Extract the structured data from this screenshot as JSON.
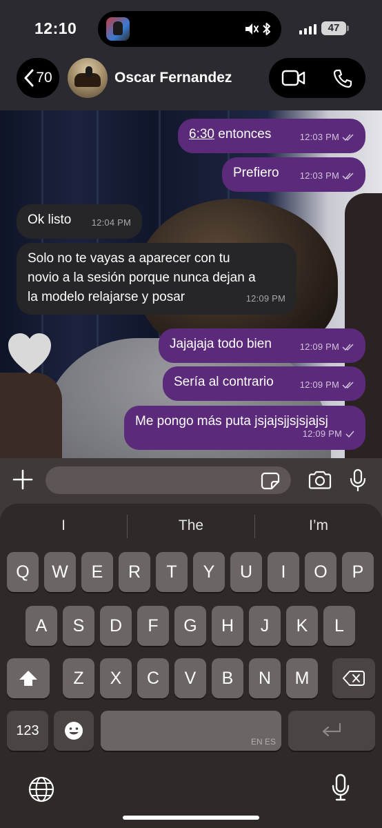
{
  "status_bar": {
    "time": "12:10",
    "battery": "47",
    "icons": [
      "app-icon",
      "mute-icon",
      "bluetooth-icon",
      "signal-icon",
      "battery-icon"
    ]
  },
  "header": {
    "back_count": "70",
    "contact_name": "Oscar Fernandez",
    "icons": [
      "back-chevron-icon",
      "video-call-icon",
      "phone-call-icon"
    ]
  },
  "messages": [
    {
      "direction": "out",
      "text_pre": "6:30",
      "text": " entonces",
      "time": "12:03 PM",
      "status": "read"
    },
    {
      "direction": "out",
      "text": "Prefiero",
      "time": "12:03 PM",
      "status": "read"
    },
    {
      "direction": "in",
      "text": "Ok listo",
      "time": "12:04 PM"
    },
    {
      "direction": "in",
      "lines": [
        "Solo no te vayas a aparecer con tu",
        "novio a la sesión porque nunca dejan a",
        "la modelo relajarse y posar"
      ],
      "time": "12:09 PM"
    },
    {
      "direction": "out",
      "text": "Jajajaja todo bien",
      "time": "12:09 PM",
      "status": "read"
    },
    {
      "direction": "out",
      "text": "Sería al contrario",
      "time": "12:09 PM",
      "status": "read"
    },
    {
      "direction": "out",
      "text": "Me pongo más puta jsjajsjjsjsjajsj",
      "time": "12:09 PM",
      "status": "delivered"
    }
  ],
  "reaction_icon": "heart-icon",
  "composer": {
    "placeholder": "",
    "icons": [
      "plus-icon",
      "sticker-icon",
      "camera-icon",
      "microphone-icon"
    ]
  },
  "keyboard": {
    "suggestions": [
      "I",
      "The",
      "I’m"
    ],
    "row1": [
      "Q",
      "W",
      "E",
      "R",
      "T",
      "Y",
      "U",
      "I",
      "O",
      "P"
    ],
    "row2": [
      "A",
      "S",
      "D",
      "F",
      "G",
      "H",
      "J",
      "K",
      "L"
    ],
    "row3": [
      "Z",
      "X",
      "C",
      "V",
      "B",
      "N",
      "M"
    ],
    "numbers_key": "123",
    "space_language": "EN ES",
    "icons": [
      "shift-icon",
      "backspace-icon",
      "emoji-icon",
      "return-icon",
      "globe-icon",
      "dictation-mic-icon"
    ]
  },
  "colors": {
    "outgoing_bubble": "#5c2a7a",
    "incoming_bubble": "#262628",
    "header_bg": "#2a2a30",
    "keyboard_bg": "#2f2a29",
    "key_bg": "#6b6563"
  }
}
